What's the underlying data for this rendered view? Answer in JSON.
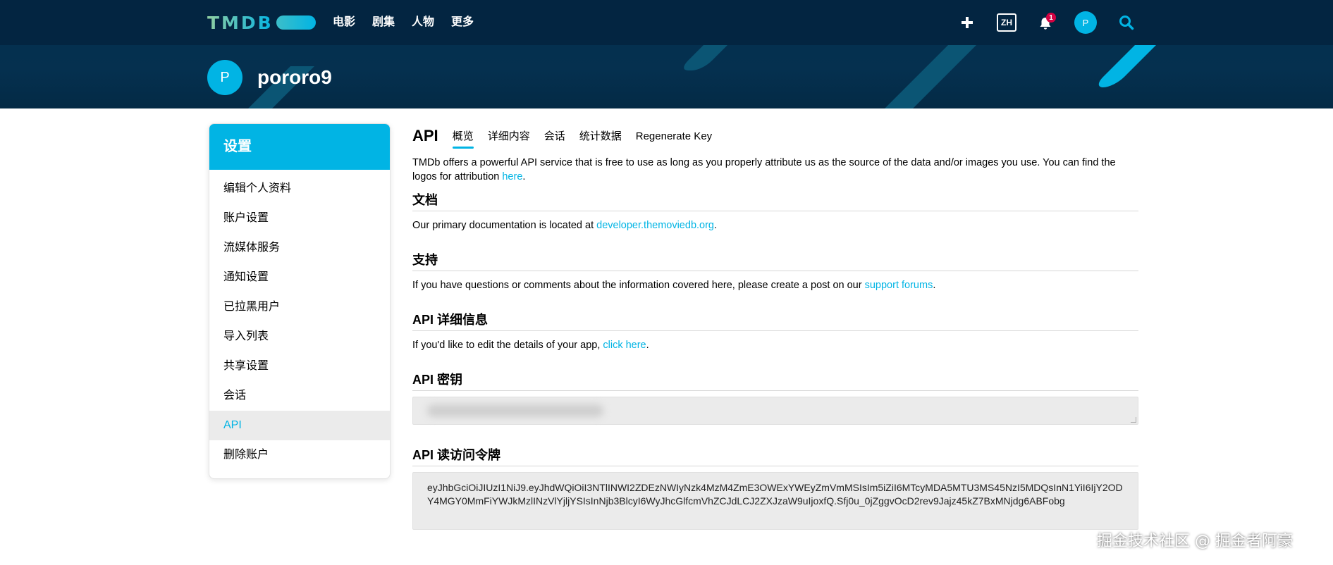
{
  "topbar": {
    "logo": "TMDB",
    "menu": [
      "电影",
      "剧集",
      "人物",
      "更多"
    ],
    "lang": "ZH",
    "notification_count": "1",
    "avatar_initial": "P"
  },
  "banner": {
    "avatar_initial": "P",
    "username": "pororo9"
  },
  "sidebar": {
    "title": "设置",
    "items": [
      "编辑个人资料",
      "账户设置",
      "流媒体服务",
      "通知设置",
      "已拉黑用户",
      "导入列表",
      "共享设置",
      "会话",
      "API",
      "删除账户"
    ],
    "active": "API"
  },
  "main": {
    "title": "API",
    "tabs": [
      "概览",
      "详细内容",
      "会话",
      "统计数据",
      "Regenerate Key"
    ],
    "active_tab": "概览",
    "intro_text": "TMDb offers a powerful API service that is free to use as long as you properly attribute us as the source of the data and/or images you use. You can find the logos for attribution ",
    "intro_link": "here",
    "docs": {
      "title": "文档",
      "text": "Our primary documentation is located at ",
      "link": "developer.themoviedb.org"
    },
    "support": {
      "title": "支持",
      "text": "If you have questions or comments about the information covered here, please create a post on our ",
      "link": "support forums"
    },
    "details": {
      "title": "API 详细信息",
      "text": "If you'd like to edit the details of your app, ",
      "link": "click here"
    },
    "key": {
      "title": "API 密钥"
    },
    "token": {
      "title": "API 读访问令牌",
      "value": "eyJhbGciOiJIUzI1NiJ9.eyJhdWQiOiI3NTlINWI2ZDEzNWIyNzk4MzM4ZmE3OWExYWEyZmVmMSIsIm5iZiI6MTcyMDA5MTU3MS45NzI5MDQsInN1YiI6IjY2ODY4MGY0MmFiYWJkMzlINzVlYjljYSIsInNjb3BlcyI6WyJhcGlfcmVhZCJdLCJ2ZXJzaW9uIjoxfQ.Sfj0u_0jZggvOcD2rev9Jajz45kZ7BxMNjdg6ABFobg"
    }
  },
  "watermark": "掘金技术社区 @ 掘金者阿豪",
  "colors": {
    "navy": "#032541",
    "accent": "#01b4e4",
    "badge": "#d40242"
  }
}
